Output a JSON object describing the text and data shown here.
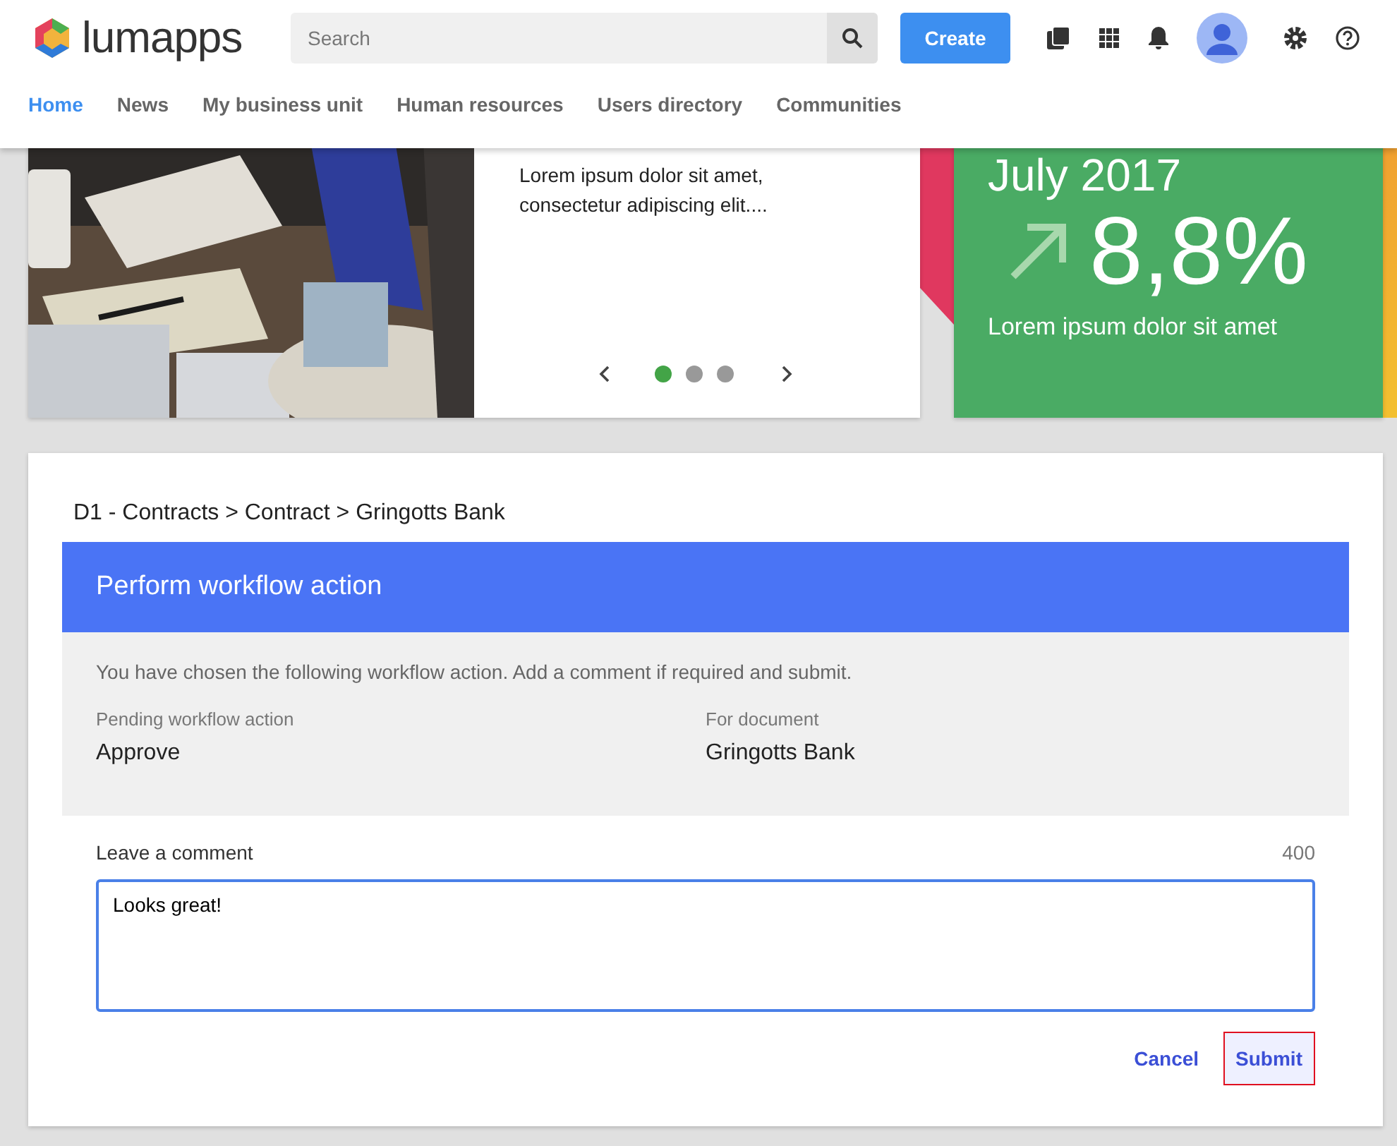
{
  "header": {
    "logo": "lumapps",
    "search": {
      "placeholder": "Search"
    },
    "create_button": "Create"
  },
  "nav": [
    {
      "label": "Home",
      "selected": true
    },
    {
      "label": "News",
      "selected": false
    },
    {
      "label": "My business unit",
      "selected": false
    },
    {
      "label": "Human resources",
      "selected": false
    },
    {
      "label": "Users directory",
      "selected": false
    },
    {
      "label": "Communities",
      "selected": false
    }
  ],
  "carousel": {
    "text": "Lorem ipsum dolor sit amet, consectetur adipiscing elit....",
    "dots": [
      {
        "selected": true
      },
      {
        "selected": false
      },
      {
        "selected": false
      }
    ]
  },
  "stat_card": {
    "period": "July 2017",
    "value": "8,8%",
    "caption": "Lorem ipsum dolor sit amet"
  },
  "workflow": {
    "breadcrumb": "D1 - Contracts > Contract > Gringotts Bank",
    "title": "Perform workflow action",
    "intro": "You have chosen the following workflow action. Add a comment if required and submit.",
    "fields": [
      {
        "label": "Pending workflow action",
        "value": "Approve"
      },
      {
        "label": "For document",
        "value": "Gringotts Bank"
      }
    ],
    "comment": {
      "label": "Leave a comment",
      "counter": "400",
      "value": "Looks great!"
    },
    "buttons": [
      {
        "label": "Cancel",
        "kind": "cancel"
      },
      {
        "label": "Submit",
        "kind": "submit"
      }
    ]
  }
}
